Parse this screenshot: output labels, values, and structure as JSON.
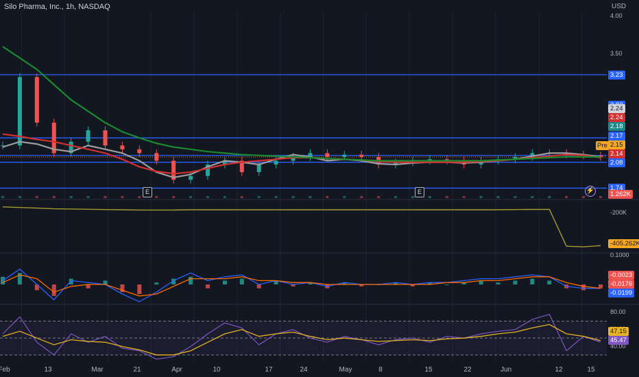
{
  "header": {
    "title": "Silo Pharma, Inc., 1h, NASDAQ",
    "currency": "USD"
  },
  "colors": {
    "background": "#131722",
    "grid": "#1f2430",
    "up": "#26a69a",
    "down": "#ef5350",
    "hline": "#2962ff",
    "ma_long": "#1b8a2e",
    "ma_mid": "#d32f2f",
    "ma_short": "#9e9e9e",
    "obv": "#a59b2f",
    "macd": "#2962ff",
    "signal": "#ff6d00",
    "rsi": "#7e57c2",
    "rsi_ma": "#e6b422"
  },
  "chart_data": [
    {
      "type": "candlestick",
      "title": "Silo Pharma, Inc., 1h, NASDAQ",
      "y_ticks": [
        "4.00",
        "3.50"
      ],
      "ylim": [
        1.6,
        4.05
      ],
      "x_ticks": [
        "Feb",
        "13",
        "Mar",
        "21",
        "Apr",
        "10",
        "17",
        "24",
        "May",
        "8",
        "15",
        "22",
        "Jun",
        "12",
        "15"
      ],
      "horizontal_levels": [
        3.23,
        2.4,
        2.17,
        2.08,
        1.74
      ],
      "price_labels": [
        {
          "text": "3.23",
          "role": "level"
        },
        {
          "text": "2.83",
          "role": "level"
        },
        {
          "text": "2.40",
          "role": "level"
        },
        {
          "text": "2.24",
          "role": "ma-short"
        },
        {
          "text": "2.24",
          "role": "ma-mid"
        },
        {
          "text": "2.18",
          "role": "ma-long"
        },
        {
          "text": "2.17",
          "role": "level"
        },
        {
          "text": "2.15",
          "role": "last"
        },
        {
          "text": "2.14",
          "role": "ma"
        },
        {
          "text": "2.08",
          "role": "level"
        },
        {
          "text": "1.74",
          "role": "level"
        },
        {
          "text": "1.262K",
          "role": "volume"
        }
      ],
      "pre_label": "Pre",
      "earnings_marks": [
        "E",
        "E"
      ],
      "series": [
        {
          "name": "close",
          "values": [
            2.3,
            3.2,
            2.6,
            2.2,
            2.35,
            2.5,
            2.3,
            2.25,
            2.2,
            2.1,
            1.85,
            1.9,
            2.05,
            2.1,
            1.95,
            2.05,
            2.1,
            2.15,
            2.2,
            2.15,
            2.18,
            2.15,
            2.05,
            2.08,
            2.1,
            2.12,
            2.1,
            2.05,
            2.1,
            2.12,
            2.15,
            2.2,
            2.2,
            2.18,
            2.17,
            2.15
          ]
        },
        {
          "name": "ma_short",
          "values": [
            2.28,
            2.35,
            2.32,
            2.25,
            2.22,
            2.3,
            2.25,
            2.2,
            2.1,
            1.95,
            1.88,
            1.92,
            2.02,
            2.1,
            2.08,
            2.05,
            2.12,
            2.18,
            2.15,
            2.1,
            2.12,
            2.1,
            2.06,
            2.05,
            2.07,
            2.08,
            2.08,
            2.07,
            2.08,
            2.1,
            2.12,
            2.16,
            2.2,
            2.2,
            2.18,
            2.15
          ]
        },
        {
          "name": "ma_mid",
          "values": [
            2.45,
            2.42,
            2.38,
            2.35,
            2.3,
            2.25,
            2.2,
            2.12,
            2.02,
            1.96,
            1.93,
            1.95,
            2.0,
            2.05,
            2.08,
            2.1,
            2.12,
            2.14,
            2.14,
            2.13,
            2.12,
            2.11,
            2.09,
            2.08,
            2.08,
            2.08,
            2.08,
            2.08,
            2.09,
            2.1,
            2.12,
            2.14,
            2.16,
            2.18,
            2.17,
            2.14
          ]
        },
        {
          "name": "ma_long",
          "values": [
            3.6,
            3.45,
            3.3,
            3.1,
            2.9,
            2.75,
            2.6,
            2.48,
            2.4,
            2.33,
            2.28,
            2.25,
            2.22,
            2.2,
            2.18,
            2.17,
            2.16,
            2.15,
            2.14,
            2.13,
            2.12,
            2.11,
            2.1,
            2.1,
            2.1,
            2.1,
            2.1,
            2.1,
            2.1,
            2.11,
            2.12,
            2.13,
            2.14,
            2.15,
            2.15,
            2.15
          ]
        }
      ]
    },
    {
      "type": "line",
      "name": "OBV",
      "y_ticks": [
        "-200K"
      ],
      "value_label": "-405.262K",
      "values": [
        -95,
        -100,
        -105,
        -110,
        -112,
        -114,
        -116,
        -118,
        -120,
        -120,
        -120,
        -118,
        -118,
        -118,
        -118,
        -118,
        -118,
        -118,
        -118,
        -118,
        -118,
        -118,
        -118,
        -118,
        -118,
        -118,
        -118,
        -118,
        -118,
        -118,
        -116,
        -115,
        -115,
        -405,
        -410,
        -400
      ]
    },
    {
      "type": "bar",
      "name": "MACD",
      "y_ticks": [
        "0.1000"
      ],
      "value_labels": [
        "-0.0023",
        "-0.0176",
        "-0.0199"
      ],
      "histogram": [
        0.04,
        0.06,
        -0.03,
        -0.06,
        0.03,
        -0.02,
        0.02,
        -0.04,
        -0.05,
        0.01,
        0.03,
        0.04,
        -0.02,
        0.02,
        0.03,
        -0.02,
        0.02,
        -0.01,
        0.01,
        -0.02,
        0.01,
        -0.01,
        0.0,
        0.01,
        -0.01,
        0.01,
        0.0,
        0.01,
        0.02,
        0.01,
        0.02,
        0.03,
        0.02,
        -0.02,
        -0.03,
        -0.02
      ],
      "macd": [
        0.02,
        0.08,
        0.0,
        -0.08,
        0.02,
        0.01,
        0.0,
        -0.05,
        -0.09,
        -0.04,
        0.02,
        0.06,
        0.02,
        0.04,
        0.05,
        0.0,
        0.02,
        0.0,
        0.01,
        -0.01,
        0.01,
        0.0,
        0.0,
        0.01,
        0.0,
        0.01,
        0.01,
        0.02,
        0.03,
        0.03,
        0.04,
        0.05,
        0.04,
        -0.01,
        -0.02,
        -0.02
      ],
      "signal": [
        0.01,
        0.05,
        0.03,
        -0.04,
        -0.01,
        0.0,
        0.0,
        -0.03,
        -0.06,
        -0.05,
        -0.01,
        0.03,
        0.03,
        0.03,
        0.04,
        0.02,
        0.02,
        0.01,
        0.01,
        0.0,
        0.0,
        0.0,
        0.0,
        0.0,
        0.0,
        0.0,
        0.01,
        0.01,
        0.02,
        0.02,
        0.03,
        0.04,
        0.04,
        0.01,
        -0.01,
        -0.02
      ]
    },
    {
      "type": "line",
      "name": "RSI",
      "y_ticks": [
        "80.00",
        "60.00",
        "40.00"
      ],
      "value_labels": [
        "47.15",
        "45.47"
      ],
      "bands": [
        70,
        50,
        30
      ],
      "rsi": [
        55,
        75,
        45,
        30,
        55,
        45,
        52,
        38,
        35,
        25,
        28,
        40,
        55,
        68,
        62,
        42,
        55,
        60,
        50,
        45,
        52,
        48,
        42,
        48,
        50,
        45,
        52,
        50,
        55,
        58,
        60,
        72,
        78,
        35,
        52,
        45
      ],
      "rsi_ma": [
        52,
        58,
        50,
        42,
        48,
        46,
        45,
        40,
        36,
        30,
        30,
        35,
        45,
        55,
        60,
        52,
        55,
        57,
        52,
        48,
        50,
        48,
        46,
        47,
        48,
        47,
        49,
        50,
        52,
        55,
        57,
        62,
        66,
        55,
        52,
        47
      ]
    }
  ]
}
